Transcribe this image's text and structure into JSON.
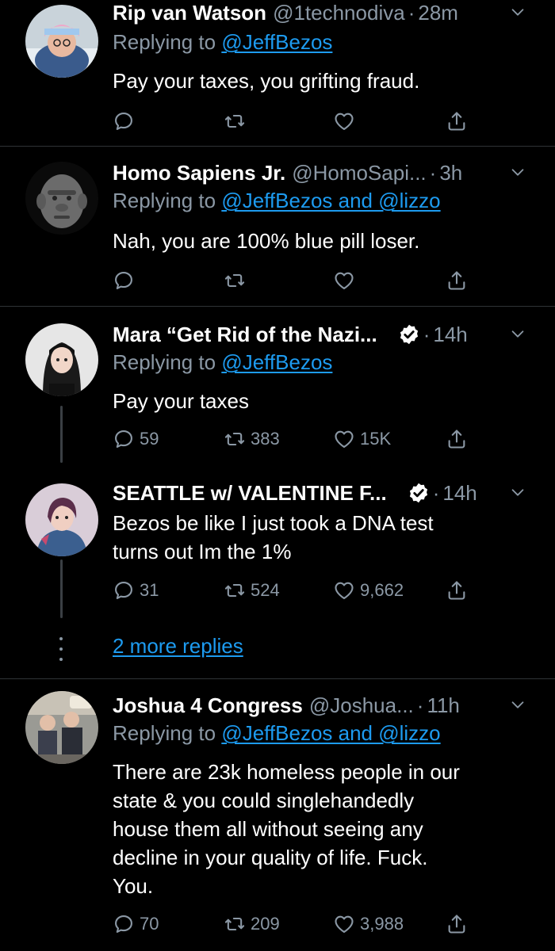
{
  "tweets": [
    {
      "name": "Rip van Watson",
      "handle": "@1technodiva",
      "time": "28m",
      "replying_prefix": "Replying to ",
      "replying_to": "@JeffBezos",
      "text": "Pay your taxes, you grifting fraud.",
      "replies": "",
      "retweets": "",
      "likes": ""
    },
    {
      "name": "Homo Sapiens Jr.",
      "handle": "@HomoSapi...",
      "time": "3h",
      "replying_prefix": "Replying to ",
      "replying_to": "@JeffBezos and @lizzo",
      "text": "Nah, you are 100% blue pill loser.",
      "replies": "",
      "retweets": "",
      "likes": ""
    },
    {
      "name": "Mara “Get Rid of the Nazi...",
      "time": "14h",
      "verified": true,
      "replying_prefix": "Replying to ",
      "replying_to": "@JeffBezos",
      "text": "Pay your taxes",
      "replies": "59",
      "retweets": "383",
      "likes": "15K"
    },
    {
      "name": "SEATTLE w/ VALENTINE F...",
      "time": "14h",
      "verified": true,
      "text_line1": "Bezos be like I just took a DNA test",
      "text_line2": "turns out Im the 1%",
      "replies": "31",
      "retweets": "524",
      "likes": "9,662"
    },
    {
      "name": "Joshua 4 Congress",
      "handle": "@Joshua...",
      "time": "11h",
      "replying_prefix": "Replying to ",
      "replying_to": "@JeffBezos and @lizzo",
      "text_lines": [
        "There are 23k homeless people in our",
        "state & you could singlehandedly",
        "house them all without seeing any",
        "decline in your quality of life.  Fuck.",
        "You."
      ],
      "replies": "70",
      "retweets": "209",
      "likes": "3,988"
    }
  ],
  "more_replies_label": "2 more replies",
  "dot_separator": "·",
  "icons": {
    "reply": "reply-icon",
    "retweet": "retweet-icon",
    "like": "like-icon",
    "share": "share-icon",
    "verified": "verified-badge-icon",
    "menu": "chevron-down-icon"
  },
  "colors": {
    "background": "#000000",
    "text": "#ffffff",
    "muted": "#8b98a5",
    "link": "#1d9bf0",
    "divider": "#2f3336"
  }
}
